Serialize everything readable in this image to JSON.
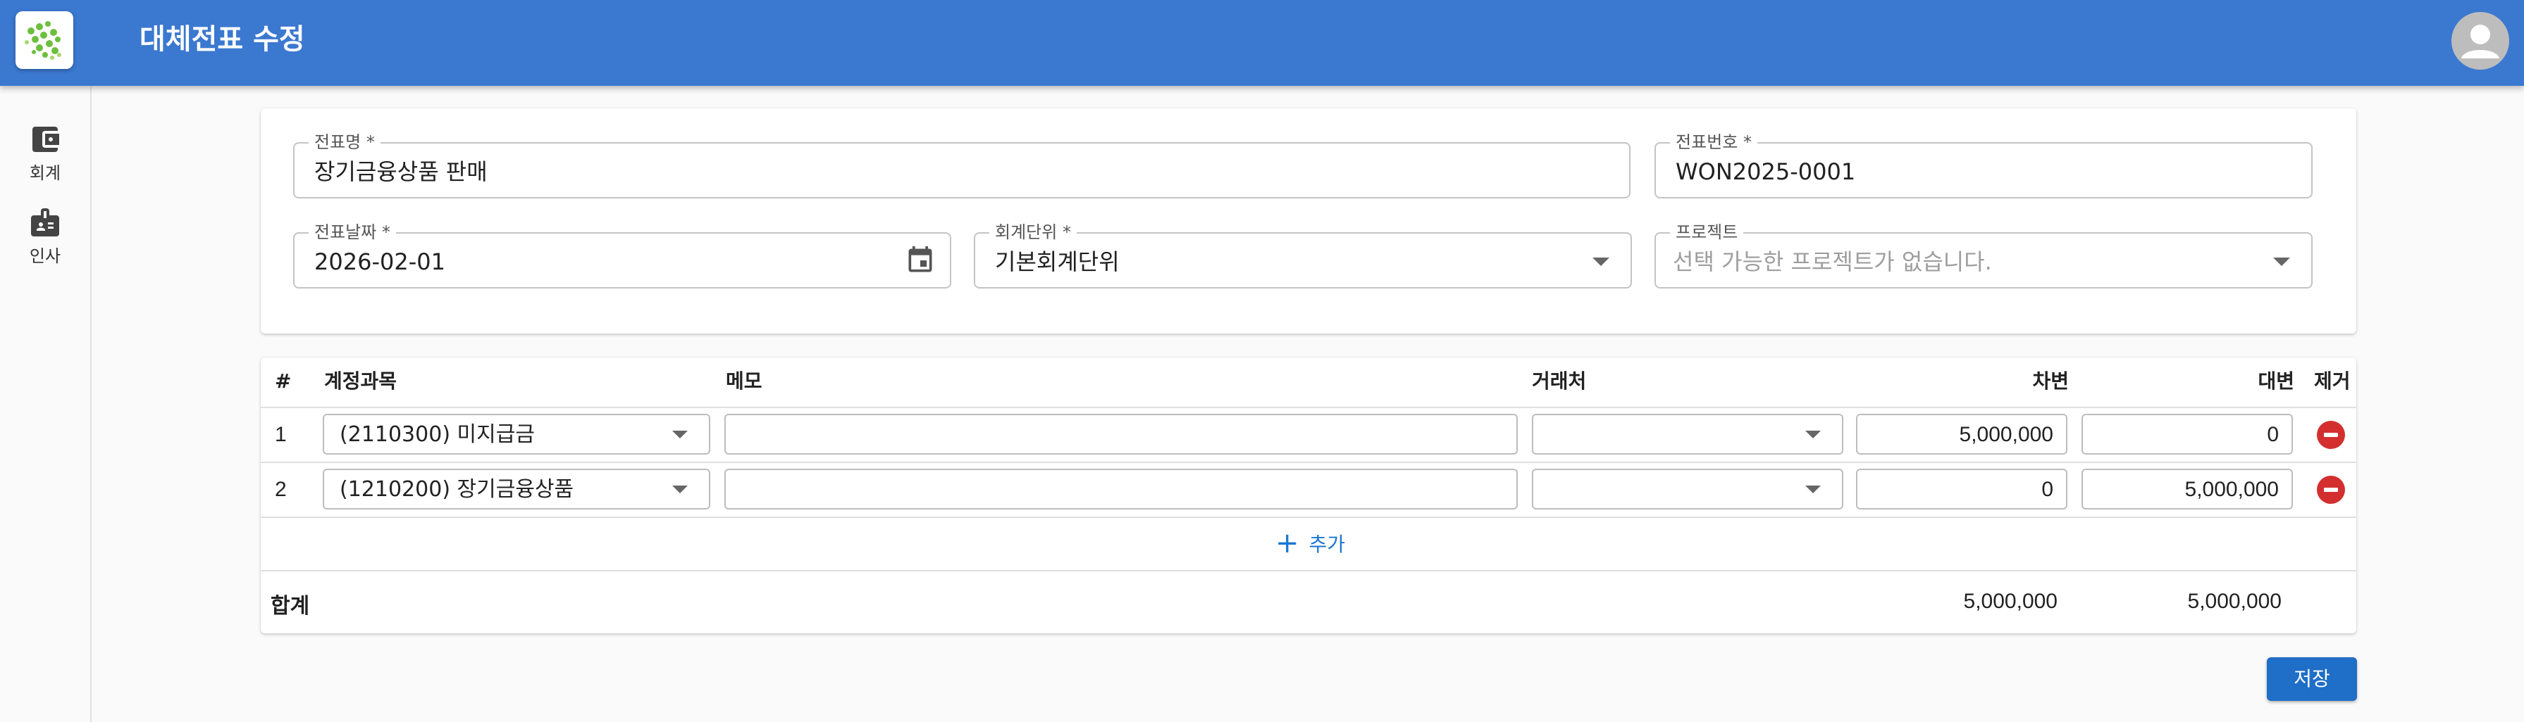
{
  "app": {
    "title": "대체전표 수정",
    "logo_icon": "app-logo-icon",
    "avatar_icon": "account-circle-icon"
  },
  "sidebar": {
    "items": [
      {
        "label": "회계",
        "icon": "wallet-icon"
      },
      {
        "label": "인사",
        "icon": "badge-icon"
      }
    ]
  },
  "form": {
    "voucher_name": {
      "label": "전표명 *",
      "value": "장기금융상품 판매"
    },
    "voucher_number": {
      "label": "전표번호 *",
      "value": "WON2025-0001"
    },
    "voucher_date": {
      "label": "전표날짜 *",
      "value": "2026-02-01",
      "icon": "calendar-icon"
    },
    "accounting_unit": {
      "label": "회계단위 *",
      "value": "기본회계단위"
    },
    "project": {
      "label": "프로젝트",
      "placeholder": "선택 가능한 프로젝트가 없습니다."
    }
  },
  "table": {
    "headers": {
      "num": "#",
      "account": "계정과목",
      "memo": "메모",
      "partner": "거래처",
      "debit": "차변",
      "credit": "대변",
      "remove": "제거"
    },
    "rows": [
      {
        "num": "1",
        "account": "(2110300) 미지급금",
        "memo": "",
        "partner": "",
        "debit": "5,000,000",
        "credit": "0"
      },
      {
        "num": "2",
        "account": "(1210200) 장기금융상품",
        "memo": "",
        "partner": "",
        "debit": "0",
        "credit": "5,000,000"
      }
    ],
    "add_label": "추가",
    "total_label": "합계",
    "total_debit": "5,000,000",
    "total_credit": "5,000,000"
  },
  "actions": {
    "save_label": "저장"
  },
  "colors": {
    "appbar": "#3b78d0",
    "primary": "#1976d2",
    "danger": "#d32f2f"
  }
}
